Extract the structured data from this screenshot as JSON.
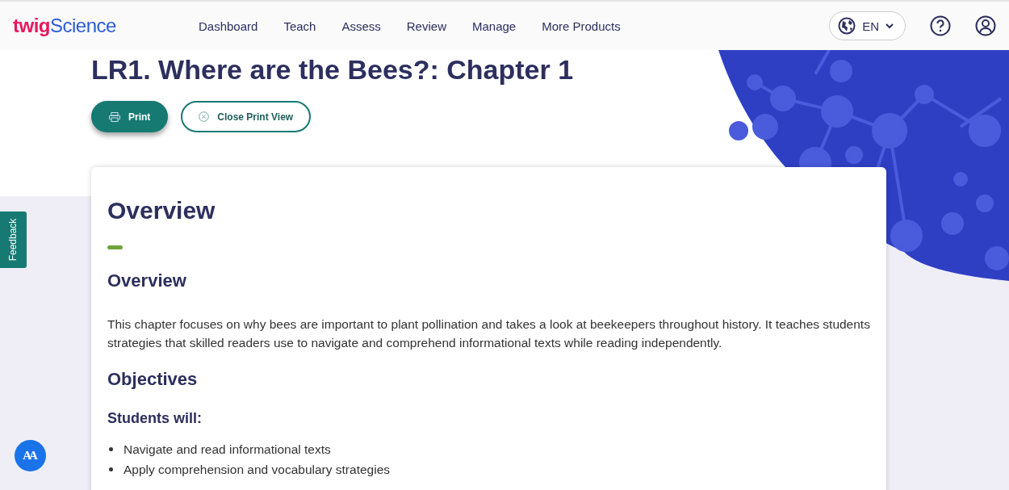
{
  "header": {
    "logo": {
      "first": "twig",
      "second": "Science"
    },
    "nav": [
      "Dashboard",
      "Teach",
      "Assess",
      "Review",
      "Manage",
      "More Products"
    ],
    "language": {
      "label": "EN"
    }
  },
  "page": {
    "title": "LR1. Where are the Bees?: Chapter 1",
    "buttons": [
      {
        "label": "Print",
        "kind": "primary"
      },
      {
        "label": "Close Print View",
        "kind": "secondary"
      }
    ]
  },
  "card": {
    "heading": "Overview",
    "sections": [
      {
        "kind": "heading",
        "text": "Overview"
      },
      {
        "kind": "paragraph",
        "text": "This chapter focuses on why bees are important to plant pollination and takes a look at beekeepers throughout history. It teaches students  strategies that skilled readers use to navigate and comprehend informational texts while reading independently."
      },
      {
        "kind": "heading",
        "text": "Objectives"
      },
      {
        "kind": "subheading",
        "text": "Students will:"
      },
      {
        "kind": "list",
        "items": [
          "Navigate and read informational texts",
          "Apply comprehension and vocabulary strategies"
        ]
      }
    ]
  },
  "feedback_tab": {
    "label": "Feedback"
  },
  "accessibility_button": {
    "label": "AA"
  }
}
